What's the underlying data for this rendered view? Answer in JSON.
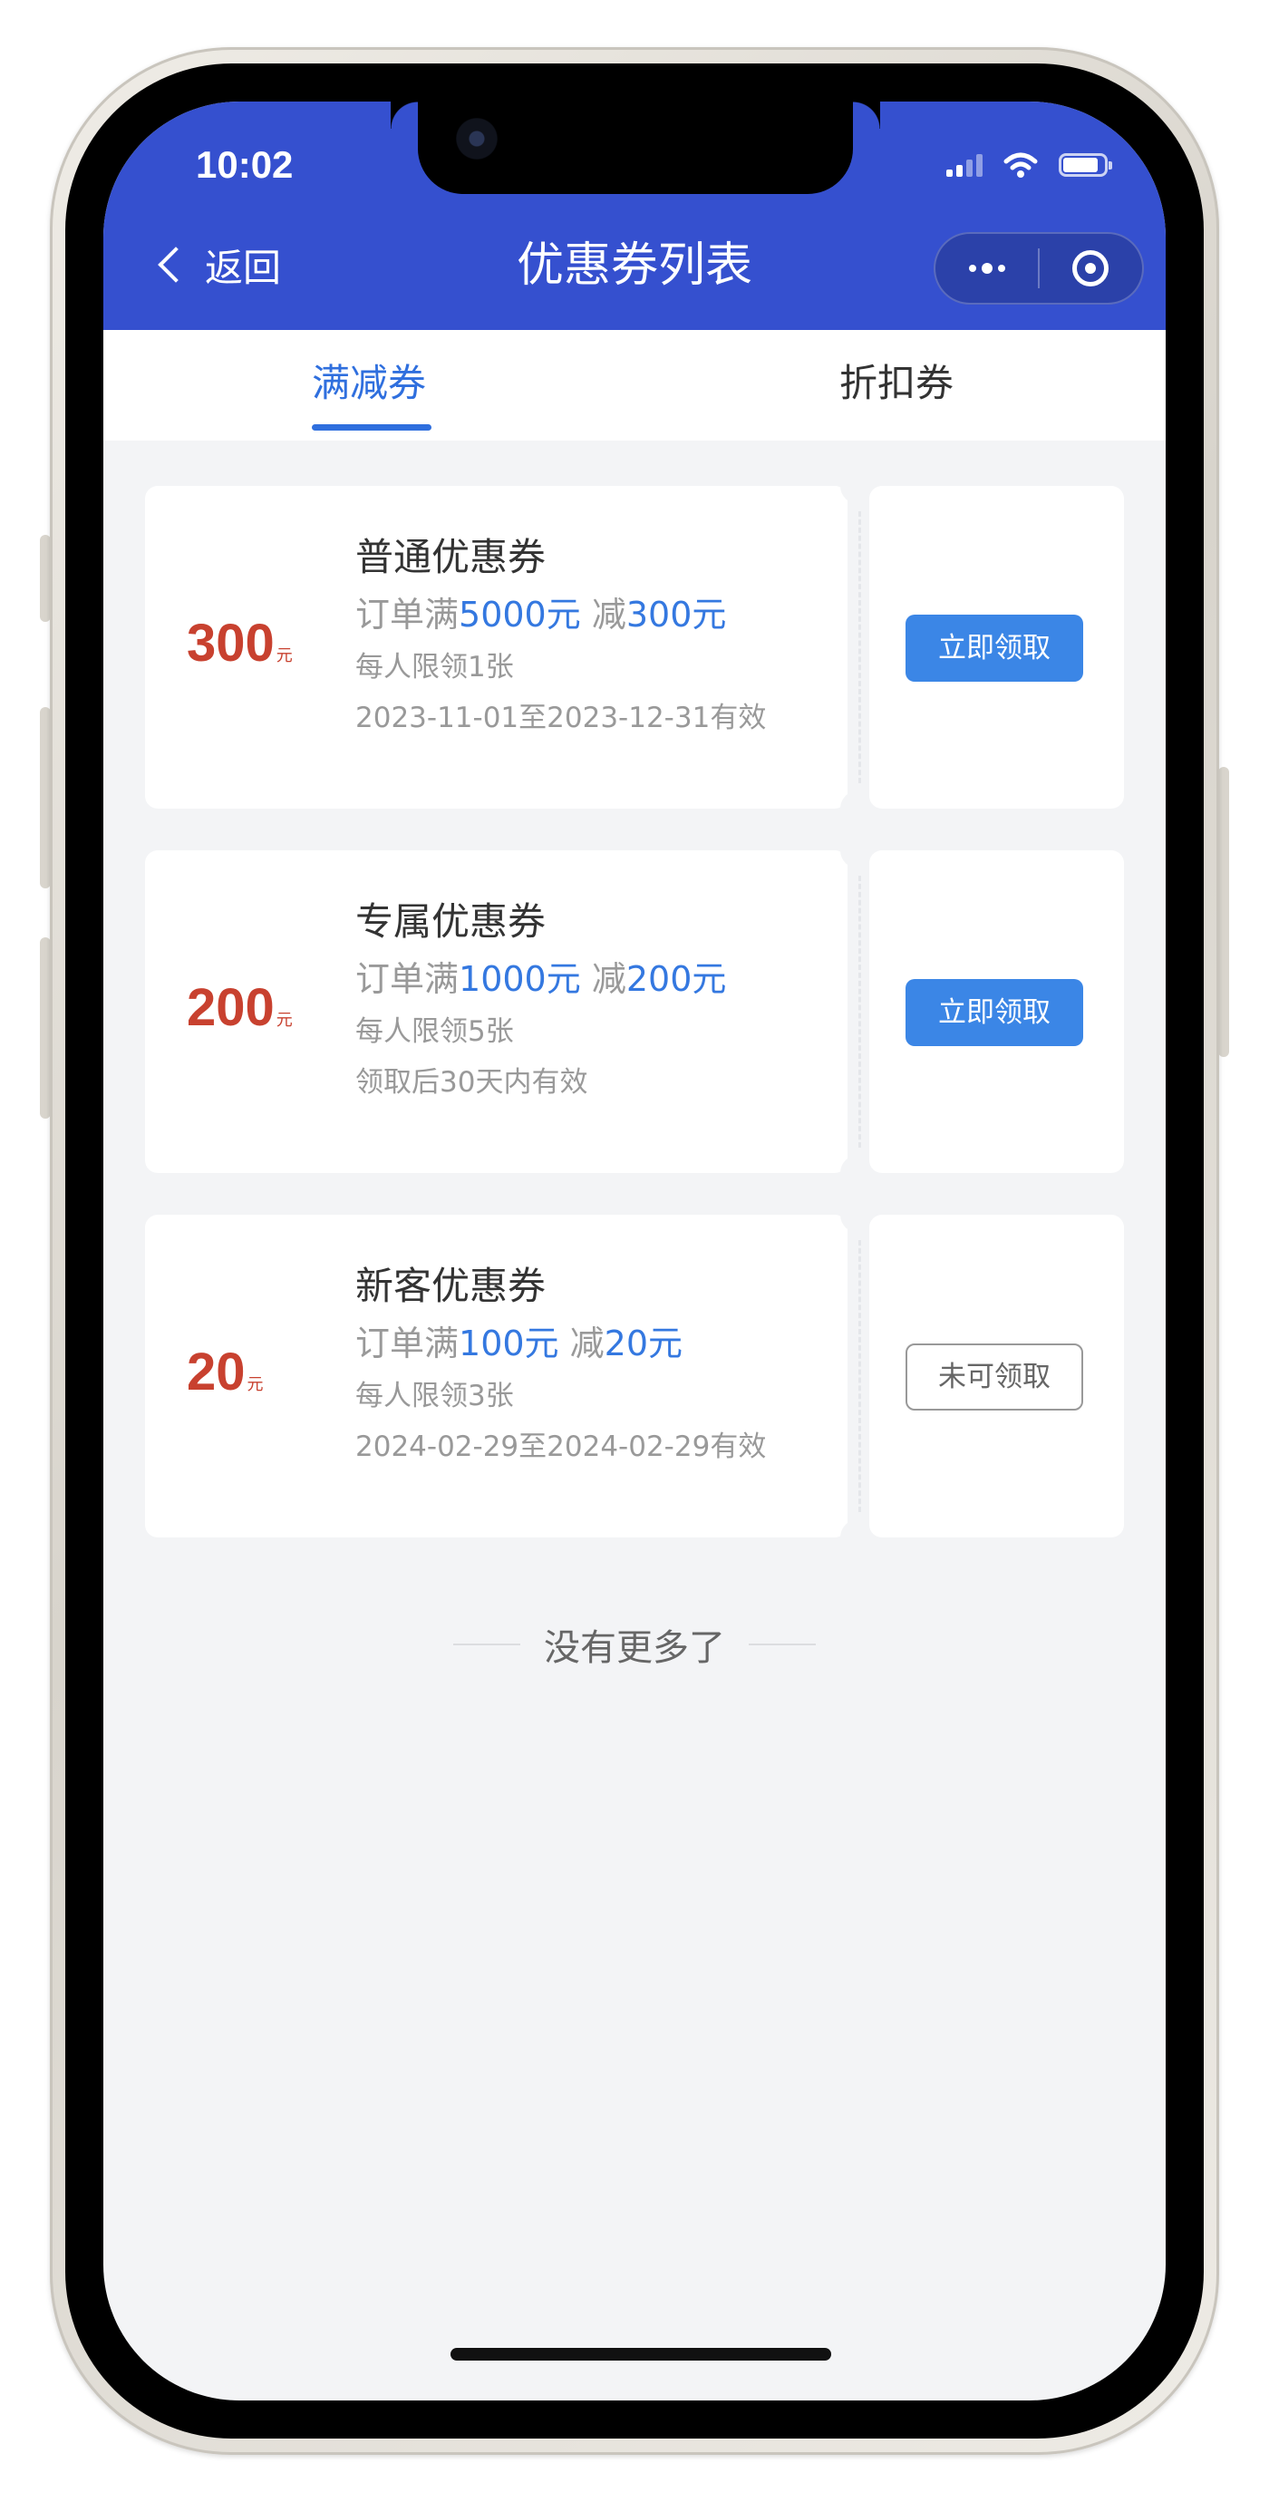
{
  "status_bar": {
    "time": "10:02"
  },
  "nav": {
    "back_label": "返回",
    "title": "优惠券列表"
  },
  "tabs": [
    {
      "label": "满减券",
      "active": true
    },
    {
      "label": "折扣券",
      "active": false
    }
  ],
  "coupons": [
    {
      "amount": "300",
      "unit": "元",
      "title": "普通优惠券",
      "rule_prefix": "订单满",
      "threshold": "5000元",
      "rule_mid": "减",
      "discount": "300元",
      "limit": "每人限领1张",
      "validity": "2023-11-01至2023-12-31有效",
      "button_label": "立即领取",
      "button_enabled": true
    },
    {
      "amount": "200",
      "unit": "元",
      "title": "专属优惠券",
      "rule_prefix": "订单满",
      "threshold": "1000元",
      "rule_mid": "减",
      "discount": "200元",
      "limit": "每人限领5张",
      "validity": "领取后30天内有效",
      "button_label": "立即领取",
      "button_enabled": true
    },
    {
      "amount": "20",
      "unit": "元",
      "title": "新客优惠券",
      "rule_prefix": "订单满",
      "threshold": "100元",
      "rule_mid": "减",
      "discount": "20元",
      "limit": "每人限领3张",
      "validity": "2024-02-29至2024-02-29有效",
      "button_label": "未可领取",
      "button_enabled": false
    }
  ],
  "footer": {
    "no_more_text": "没有更多了"
  },
  "colors": {
    "nav_bar": "#3550cf",
    "accent_blue": "#2f6fde",
    "amount_red": "#c8412f",
    "button_blue": "#3b86e6"
  },
  "icons": [
    "back-chevron-icon",
    "more-dots-icon",
    "close-target-icon",
    "signal-icon",
    "wifi-icon",
    "battery-icon"
  ]
}
